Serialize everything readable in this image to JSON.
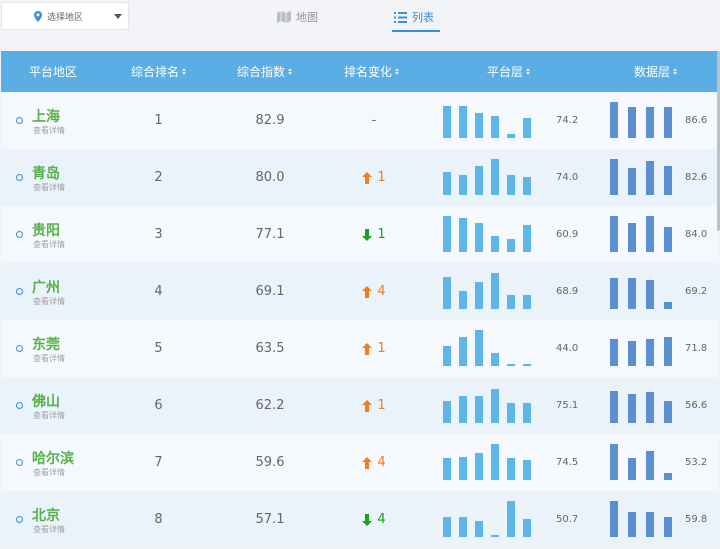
{
  "toolbar": {
    "region_select_label": "选择地区",
    "tab_map_label": "地图",
    "tab_list_label": "列表",
    "active_tab": "列表"
  },
  "table": {
    "columns": [
      "平台地区",
      "综合排名",
      "综合指数",
      "排名变化",
      "平台层",
      "数据层"
    ],
    "detail_label": "查看详情",
    "rows": [
      {
        "city": "上海",
        "rank": "1",
        "score": "82.9",
        "change_dir": "none",
        "change_text": "-",
        "platform_value": "74.2",
        "data_value": "86.6",
        "platform_bars": [
          0.9,
          0.9,
          0.7,
          0.6,
          0.1,
          0.55
        ],
        "data_bars": [
          1.0,
          0.85,
          0.85,
          0.85
        ]
      },
      {
        "city": "青岛",
        "rank": "2",
        "score": "80.0",
        "change_dir": "up",
        "change_text": "1",
        "platform_value": "74.0",
        "data_value": "82.6",
        "platform_bars": [
          0.65,
          0.55,
          0.8,
          1.0,
          0.55,
          0.5
        ],
        "data_bars": [
          1.0,
          0.75,
          0.95,
          0.8
        ]
      },
      {
        "city": "贵阳",
        "rank": "3",
        "score": "77.1",
        "change_dir": "down",
        "change_text": "1",
        "platform_value": "60.9",
        "data_value": "84.0",
        "platform_bars": [
          1.0,
          0.95,
          0.8,
          0.45,
          0.35,
          0.75
        ],
        "data_bars": [
          1.0,
          0.8,
          1.0,
          0.7
        ]
      },
      {
        "city": "广州",
        "rank": "4",
        "score": "69.1",
        "change_dir": "up",
        "change_text": "4",
        "platform_value": "68.9",
        "data_value": "69.2",
        "platform_bars": [
          0.9,
          0.5,
          0.75,
          1.0,
          0.4,
          0.4
        ],
        "data_bars": [
          0.85,
          0.85,
          0.8,
          0.2
        ]
      },
      {
        "city": "东莞",
        "rank": "5",
        "score": "63.5",
        "change_dir": "up",
        "change_text": "1",
        "platform_value": "44.0",
        "data_value": "71.8",
        "platform_bars": [
          0.55,
          0.8,
          1.0,
          0.35,
          0.05,
          0.05
        ],
        "data_bars": [
          0.75,
          0.7,
          0.75,
          0.8
        ]
      },
      {
        "city": "佛山",
        "rank": "6",
        "score": "62.2",
        "change_dir": "up",
        "change_text": "1",
        "platform_value": "75.1",
        "data_value": "56.6",
        "platform_bars": [
          0.6,
          0.75,
          0.75,
          0.95,
          0.55,
          0.55
        ],
        "data_bars": [
          0.9,
          0.8,
          0.85,
          0.6
        ]
      },
      {
        "city": "哈尔滨",
        "rank": "7",
        "score": "59.6",
        "change_dir": "up",
        "change_text": "4",
        "platform_value": "74.5",
        "data_value": "53.2",
        "platform_bars": [
          0.6,
          0.65,
          0.75,
          1.0,
          0.6,
          0.55
        ],
        "data_bars": [
          1.0,
          0.6,
          0.8,
          0.2
        ]
      },
      {
        "city": "北京",
        "rank": "8",
        "score": "57.1",
        "change_dir": "down",
        "change_text": "4",
        "platform_value": "50.7",
        "data_value": "59.8",
        "platform_bars": [
          0.55,
          0.55,
          0.45,
          0.05,
          1.0,
          0.5
        ],
        "data_bars": [
          1.0,
          0.7,
          0.7,
          0.55
        ]
      }
    ]
  },
  "colors": {
    "header_bg": "#5aaee3",
    "city_green": "#58b04a",
    "rank_up_orange": "#f07d1e",
    "rank_down_green": "#1e9e1e",
    "platform_bar": "#5db5e8",
    "data_bar": "#5a8fd0",
    "active_tab_blue": "#3a8fd8"
  }
}
